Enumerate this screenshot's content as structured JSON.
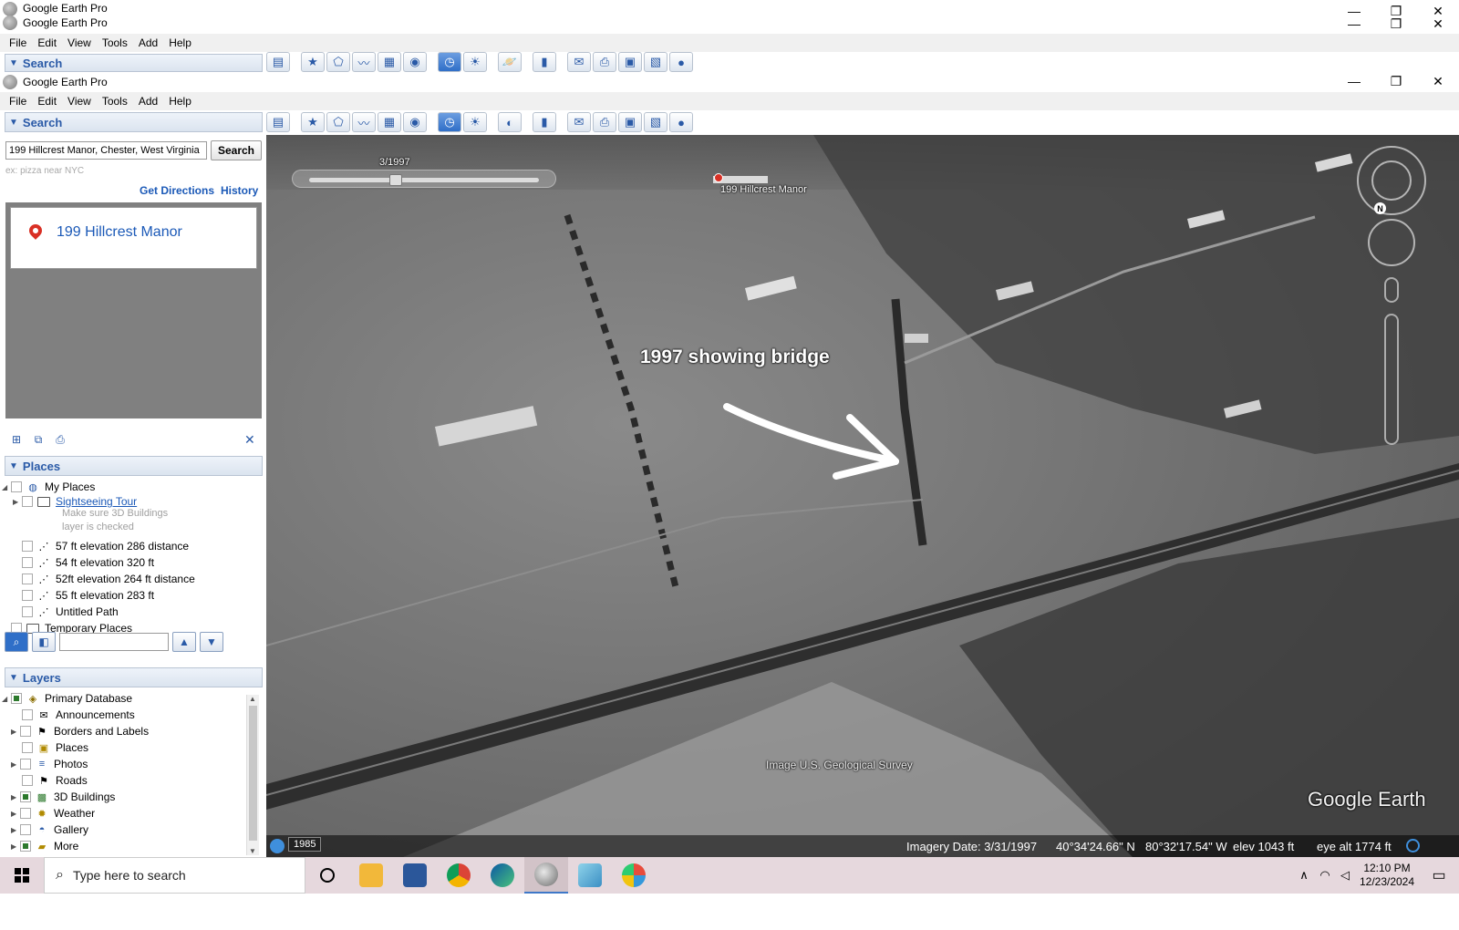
{
  "app_title": "Google Earth Pro",
  "menu": [
    "File",
    "Edit",
    "View",
    "Tools",
    "Add",
    "Help"
  ],
  "window_controls": {
    "minimize": "—",
    "restore": "❐",
    "close": "✕"
  },
  "search_panel": {
    "header": "Search",
    "input_value": "199 Hillcrest Manor, Chester, West Virginia",
    "search_button": "Search",
    "placeholder_hint": "ex: pizza near NYC",
    "get_directions": "Get Directions",
    "history": "History",
    "result_name": "199 Hillcrest Manor"
  },
  "places_panel": {
    "header": "Places",
    "items": [
      {
        "label": "My Places",
        "level": 0
      },
      {
        "label": "Sightseeing Tour",
        "level": 1
      },
      {
        "label": "57 ft elevation 286 distance",
        "level": 1
      },
      {
        "label": "54 ft elevation 320 ft",
        "level": 1
      },
      {
        "label": "52ft elevation 264 ft distance",
        "level": 1
      },
      {
        "label": "55 ft  elevation 283 ft",
        "level": 1
      },
      {
        "label": "Untitled Path",
        "level": 1
      },
      {
        "label": "Temporary Places",
        "level": 0
      }
    ],
    "tour_hint_line1": "Make sure 3D Buildings",
    "tour_hint_line2": "layer is checked"
  },
  "layers_panel": {
    "header": "Layers",
    "items": [
      {
        "label": "Primary Database"
      },
      {
        "label": "Announcements"
      },
      {
        "label": "Borders and Labels"
      },
      {
        "label": "Places"
      },
      {
        "label": "Photos"
      },
      {
        "label": "Roads"
      },
      {
        "label": "3D Buildings"
      },
      {
        "label": "Weather"
      },
      {
        "label": "Gallery"
      },
      {
        "label": "More"
      }
    ]
  },
  "map": {
    "time_slider_label": "3/1997",
    "placemark_label": "199 Hillcrest Manor",
    "annotation": "1997 showing bridge",
    "attribution": "Image U.S. Geological Survey",
    "brand": "Google Earth",
    "compass_north": "N",
    "history_year": "1985",
    "status": {
      "imagery_date": "Imagery Date: 3/31/1997",
      "lat": "40°34'24.66\" N",
      "lon": "80°32'17.54\" W",
      "elev": "elev  1043 ft",
      "eye_alt": "eye alt   1774 ft"
    }
  },
  "taskbar": {
    "search_placeholder": "Type here to search",
    "time": "12:10 PM",
    "date": "12/23/2024"
  }
}
